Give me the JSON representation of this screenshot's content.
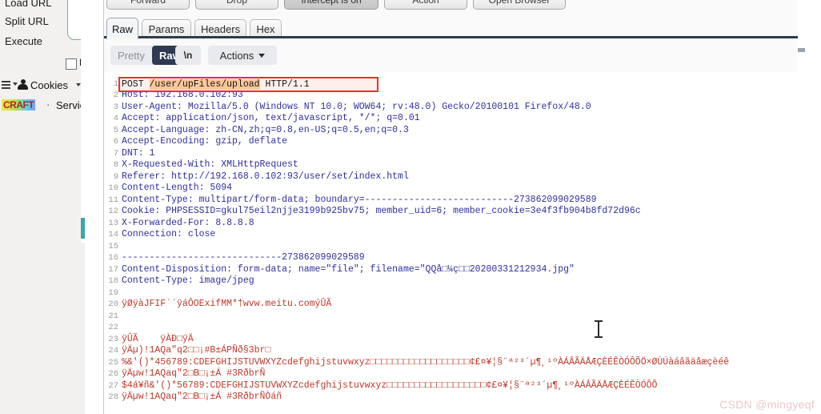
{
  "background_window": {
    "links": [
      {
        "label": "Load URL"
      },
      {
        "label": "Split URL"
      },
      {
        "label": "Execute"
      }
    ],
    "post_checkbox_label": "Po",
    "cookies_label": "Cookies",
    "craft_label": "CRAFT",
    "separator": "·",
    "services_label": "Services"
  },
  "burp": {
    "action_buttons": [
      {
        "label": "Forward",
        "state": "normal"
      },
      {
        "label": "Drop",
        "state": "normal"
      },
      {
        "label": "Intercept is on",
        "state": "on"
      },
      {
        "label": "Action",
        "state": "normal"
      },
      {
        "label": "Open Browser",
        "state": "normal"
      }
    ],
    "tabs": [
      {
        "label": "Raw",
        "active": true
      },
      {
        "label": "Params",
        "active": false
      },
      {
        "label": "Headers",
        "active": false
      },
      {
        "label": "Hex",
        "active": false
      }
    ],
    "view_toggle": [
      {
        "label": "Pretty",
        "active": false
      },
      {
        "label": "Raw",
        "active": true
      }
    ],
    "newline_button": "\\n",
    "actions_button": "Actions",
    "accent_color": "#2f3a52",
    "highlight_color": "#fbc79a",
    "selection_border_color": "#f42c2c"
  },
  "request": {
    "highlighted_line": {
      "number": "1",
      "method": "POST ",
      "path": "/user/upFiles/upload",
      "version": " HTTP/1.1"
    },
    "lines": [
      {
        "n": "2",
        "text": "Host: 192.168.0.102:93",
        "color": "blue"
      },
      {
        "n": "3",
        "text": "User-Agent: Mozilla/5.0 (Windows NT 10.0; WOW64; rv:48.0) Gecko/20100101 Firefox/48.0",
        "color": "blue"
      },
      {
        "n": "4",
        "text": "Accept: application/json, text/javascript, */*; q=0.01",
        "color": "blue"
      },
      {
        "n": "5",
        "text": "Accept-Language: zh-CN,zh;q=0.8,en-US;q=0.5,en;q=0.3",
        "color": "blue"
      },
      {
        "n": "6",
        "text": "Accept-Encoding: gzip, deflate",
        "color": "blue"
      },
      {
        "n": "7",
        "text": "DNT: 1",
        "color": "blue"
      },
      {
        "n": "8",
        "text": "X-Requested-With: XMLHttpRequest",
        "color": "blue"
      },
      {
        "n": "9",
        "text": "Referer: http://192.168.0.102:93/user/set/index.html",
        "color": "blue"
      },
      {
        "n": "10",
        "text": "Content-Length: 5094",
        "color": "blue"
      },
      {
        "n": "11",
        "text": "Content-Type: multipart/form-data; boundary=---------------------------273862099029589",
        "color": "blue"
      },
      {
        "n": "12",
        "text": "Cookie: PHPSESSID=gkul75eil2njje3199b925bv75; member_uid=6; member_cookie=3e4f3fb904b8fd72d96c",
        "color": "blue"
      },
      {
        "n": "13",
        "text": "X-Forwarded-For: 8.8.8.8",
        "color": "blue"
      },
      {
        "n": "14",
        "text": "Connection: close",
        "color": "blue"
      },
      {
        "n": "15",
        "text": "",
        "color": "blue"
      },
      {
        "n": "16",
        "text": "-----------------------------273862099029589",
        "color": "blue"
      },
      {
        "n": "17",
        "text": "Content-Disposition: form-data; name=\"file\"; filename=\"QQå□¼ç□□20200331212934.jpg\"",
        "color": "blue"
      },
      {
        "n": "18",
        "text": "Content-Type: image/jpeg",
        "color": "blue"
      },
      {
        "n": "19",
        "text": "",
        "color": "blue"
      },
      {
        "n": "20",
        "text": "ÿØÿàJFIF``ÿáÔOExifMM*†wvw.meitu.comýÛÃ",
        "color": "red"
      },
      {
        "n": "21",
        "text": "",
        "color": "red"
      },
      {
        "n": "22",
        "text": "",
        "color": "red"
      },
      {
        "n": "23",
        "text": "ÿÛÃ    ÿÀÐ□ÿÄ",
        "color": "red"
      },
      {
        "n": "24",
        "text": "ÿÄµ)!1AQa\"q2□□¡#B±ÁPÑð§3br□",
        "color": "red"
      },
      {
        "n": "25",
        "text": "%&'()*456789:CDEFGHIJSTUVWXYZcdefghijstuvwxyz□□□□□□□□□□□□□□□□□□¢£¤¥¦§¨ª²³´µ¶¸¹ºÀÁÂÃÄÅÆÇÈÉÊÒÓÔÕÖ×ØÙÚàáâãäåæçèéê",
        "color": "red"
      },
      {
        "n": "26",
        "text": "ÿÄµw!1AQaq\"2□B□¡±Á #3RðbrÑ",
        "color": "red"
      },
      {
        "n": "27",
        "text": "$4á¥ñ&'()*56789:CDEFGHIJSTUVWXYZcdefghijstuvwxyz□□□□□□□□□□□□□□□□□□¢£¤¥¦§¨ª²³´µ¶¸¹ºÀÁÂÃÄÅÆÇÈÉÊÒÓÔÕ",
        "color": "red"
      },
      {
        "n": "28",
        "text": "ÿÄµw!1AQaq\"2□B□¡±Á #3RðbrÑÒáñ",
        "color": "red"
      }
    ]
  },
  "watermark": "CSDN @mingyeqf"
}
